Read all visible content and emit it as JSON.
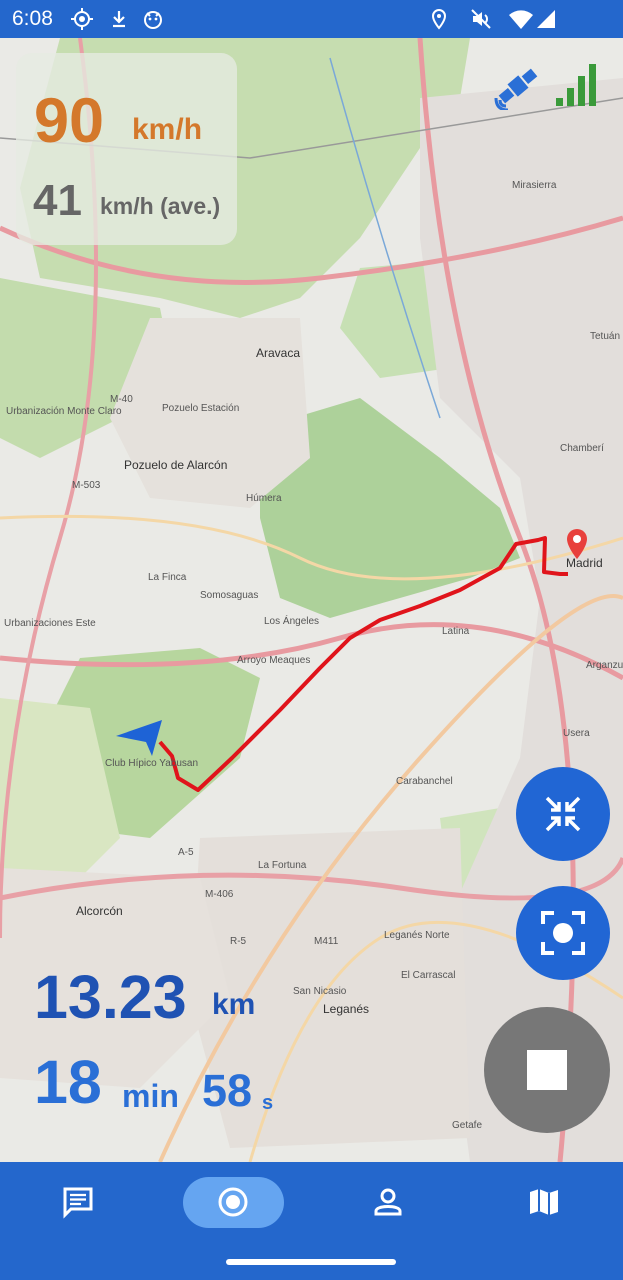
{
  "status_bar": {
    "time": "6:08",
    "left_icons": [
      "gps-crosshair-icon",
      "download-icon",
      "app-face-icon"
    ],
    "right_icons": [
      "location-pin-icon",
      "mute-icon",
      "wifi-icon",
      "cell-signal-icon"
    ]
  },
  "speed_panel": {
    "speed_value": "90",
    "speed_unit": "km/h",
    "avg_value": "41",
    "avg_unit": "km/h (ave.)",
    "speed_color": "#d4782b",
    "avg_color": "#666666"
  },
  "gps_status": {
    "icons": [
      "satellite-icon",
      "signal-bars-icon"
    ],
    "satellite_color": "#2a6fd6",
    "signal_color": "#3a9a3a"
  },
  "map": {
    "labels": [
      "Aravaca",
      "Pozuelo Estación",
      "Pozuelo de Alarcón",
      "Húmera",
      "Urbanización Monte Claro",
      "Somosaguas",
      "Los Ángeles",
      "Arroyo Meaques",
      "Madrid",
      "Latina",
      "Carabanchel",
      "Chamberí",
      "Tetuán",
      "Usera",
      "Arganzuela",
      "Alcorcón",
      "Leganés Norte",
      "Leganés",
      "San Nicasio",
      "El Carrascal",
      "Getafe",
      "Mirasierra",
      "Club Hípico Yabusan",
      "Urbanizaciones Este",
      "La Fortuna",
      "La Finca",
      "M-40",
      "M-503",
      "A-5",
      "M-406",
      "R-5",
      "M411"
    ],
    "route_color": "#e0141b",
    "marker_color": "#e8403c",
    "position_arrow_color": "#1e63d6"
  },
  "trip": {
    "distance_value": "13.23",
    "distance_unit": "km",
    "minutes_value": "18",
    "minutes_unit": "min",
    "seconds_value": "58",
    "seconds_unit": "s"
  },
  "fabs": {
    "collapse_icon": "collapse-arrows-icon",
    "center_icon": "center-focus-icon",
    "stop_icon": "stop-icon"
  },
  "bottom_nav": {
    "items": [
      {
        "icon": "notes-icon",
        "active": false
      },
      {
        "icon": "record-icon",
        "active": true
      },
      {
        "icon": "person-icon",
        "active": false
      },
      {
        "icon": "map-icon",
        "active": false
      }
    ],
    "active_pill_color": "#65a5f1"
  }
}
